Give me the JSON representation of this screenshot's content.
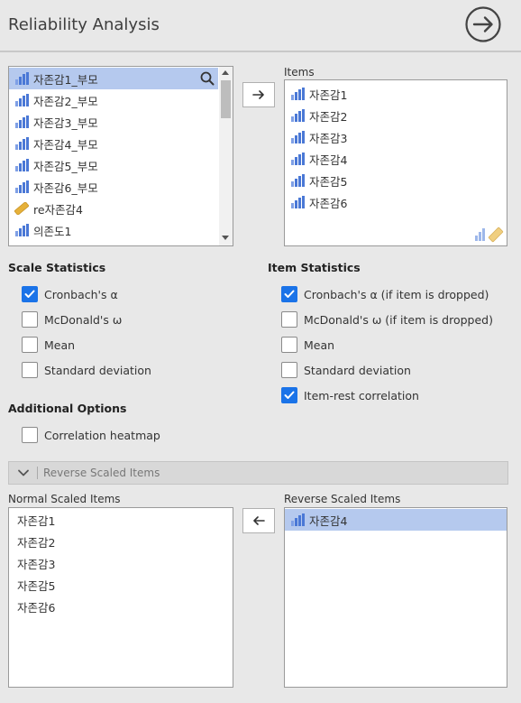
{
  "header": {
    "title": "Reliability Analysis"
  },
  "source_list": {
    "items": [
      {
        "label": "자존감1_부모",
        "icon": "continuous-bar-icon",
        "selected": true
      },
      {
        "label": "자존감2_부모",
        "icon": "continuous-bar-icon"
      },
      {
        "label": "자존감3_부모",
        "icon": "continuous-bar-icon"
      },
      {
        "label": "자존감4_부모",
        "icon": "continuous-bar-icon"
      },
      {
        "label": "자존감5_부모",
        "icon": "continuous-bar-icon"
      },
      {
        "label": "자존감6_부모",
        "icon": "continuous-bar-icon"
      },
      {
        "label": "re자존감4",
        "icon": "ruler-icon"
      },
      {
        "label": "의존도1",
        "icon": "continuous-bar-icon"
      }
    ]
  },
  "items_box": {
    "label": "Items",
    "items": [
      "자존감1",
      "자존감2",
      "자존감3",
      "자존감4",
      "자존감5",
      "자존감6"
    ]
  },
  "scale_statistics": {
    "title": "Scale Statistics",
    "options": [
      {
        "label": "Cronbach's α",
        "checked": true
      },
      {
        "label": "McDonald's ω",
        "checked": false
      },
      {
        "label": "Mean",
        "checked": false
      },
      {
        "label": "Standard deviation",
        "checked": false
      }
    ]
  },
  "item_statistics": {
    "title": "Item Statistics",
    "options": [
      {
        "label": "Cronbach's α (if item is dropped)",
        "checked": true
      },
      {
        "label": "McDonald's ω (if item is dropped)",
        "checked": false
      },
      {
        "label": "Mean",
        "checked": false
      },
      {
        "label": "Standard deviation",
        "checked": false
      },
      {
        "label": "Item-rest correlation",
        "checked": true
      }
    ]
  },
  "additional_options": {
    "title": "Additional Options",
    "options": [
      {
        "label": "Correlation heatmap",
        "checked": false
      }
    ]
  },
  "reverse_section": {
    "title": "Reverse Scaled Items",
    "normal_label": "Normal Scaled Items",
    "normal_items": [
      "자존감1",
      "자존감2",
      "자존감3",
      "자존감5",
      "자존감6"
    ],
    "reverse_label": "Reverse Scaled Items",
    "reverse_items": [
      "자존감4"
    ]
  },
  "colors": {
    "accent": "#1a73e8",
    "selection": "#b5c9ee",
    "icon_blue": "#4a78d6",
    "ruler": "#e6b13a"
  }
}
